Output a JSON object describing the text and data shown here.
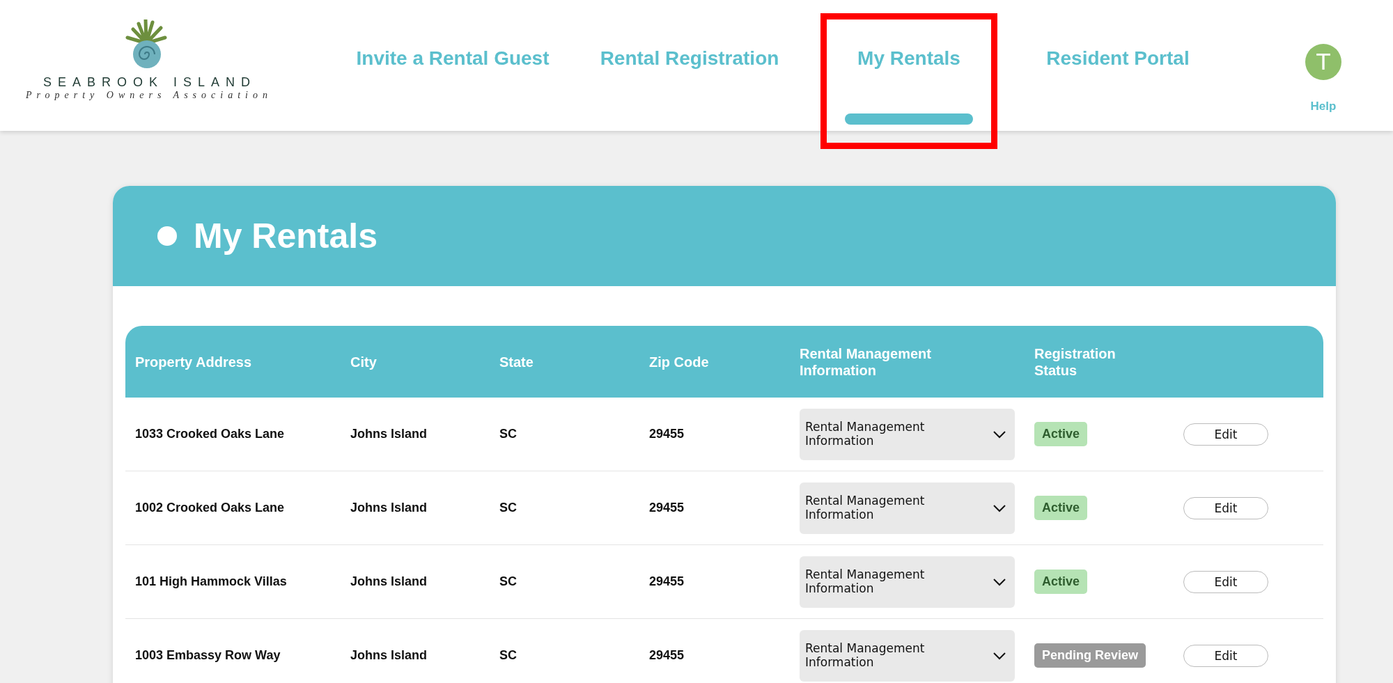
{
  "logo": {
    "name": "SEABROOK ISLAND",
    "tagline": "Property Owners Association"
  },
  "nav": [
    {
      "label": "Invite a Rental Guest",
      "selected": false
    },
    {
      "label": "Rental Registration",
      "selected": false
    },
    {
      "label": "My Rentals",
      "selected": true
    },
    {
      "label": "Resident Portal",
      "selected": false
    }
  ],
  "highlight": {
    "kind": "frame"
  },
  "user": {
    "initial": "T",
    "help": "Help"
  },
  "page_title": "My Rentals",
  "table": {
    "columns": [
      "Property Address",
      "City",
      "State",
      "Zip Code",
      "Rental Management Information",
      "Registration Status"
    ],
    "rows": [
      {
        "address": "1033 Crooked Oaks Lane",
        "city": "Johns Island",
        "state": "SC",
        "zip": "29455",
        "management": "Rental Management Information",
        "status": "Active",
        "kind": "active",
        "action": "Edit"
      },
      {
        "address": "1002 Crooked Oaks Lane",
        "city": "Johns Island",
        "state": "SC",
        "zip": "29455",
        "management": "Rental Management Information",
        "status": "Active",
        "kind": "active",
        "action": "Edit"
      },
      {
        "address": "101 High Hammock Villas",
        "city": "Johns Island",
        "state": "SC",
        "zip": "29455",
        "management": "Rental Management Information",
        "status": "Active",
        "kind": "active",
        "action": "Edit"
      },
      {
        "address": "1003 Embassy Row Way",
        "city": "Johns Island",
        "state": "SC",
        "zip": "29455",
        "management": "Rental Management Information",
        "status": "Pending Review",
        "kind": "pending",
        "action": "Edit"
      }
    ]
  }
}
